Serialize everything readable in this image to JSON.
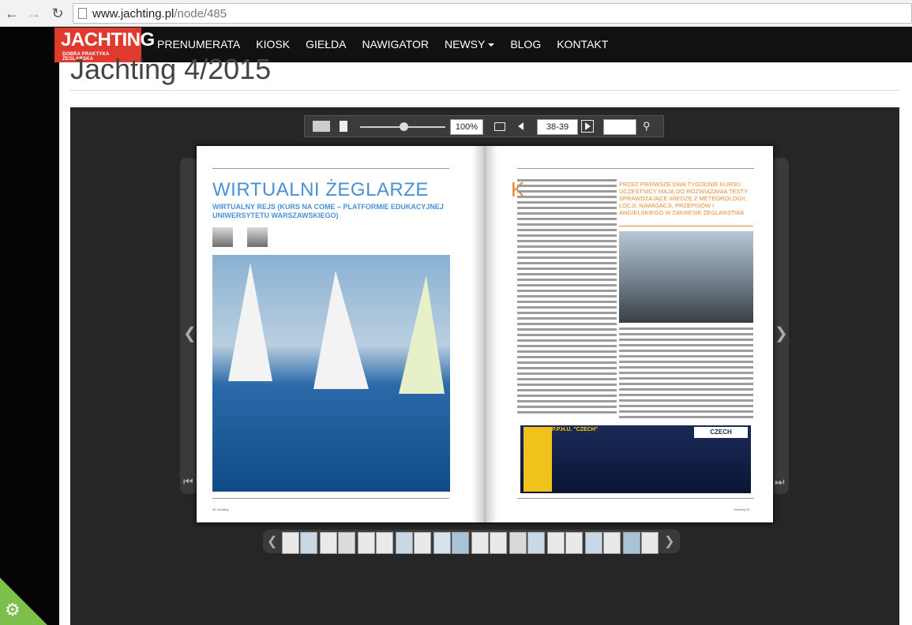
{
  "browser": {
    "url_host": "www.jachting.pl",
    "url_path": "/node/485"
  },
  "nav": {
    "logo_main": "JACHTING",
    "logo_sub": "DOBRA PRAKTYKA ŻEGLARSKA",
    "items": [
      "PRENUMERATA",
      "KIOSK",
      "GIEŁDA",
      "NAWIGATOR",
      "NEWSY",
      "BLOG",
      "KONTAKT"
    ]
  },
  "page": {
    "title": "Jachting 4/2015"
  },
  "viewer": {
    "zoom": "100%",
    "pages": "38-39",
    "search_value": ""
  },
  "left_page": {
    "title": "WIRTUALNI ŻEGLARZE",
    "subtitle": "WIRTUALNY REJS (KURS NA COME – PLATFORMIE EDUKACYJNEJ UNIWERSYTETU WARSZAWSKIEGO)",
    "folio": "38 Jachting"
  },
  "right_page": {
    "dropcap": "K",
    "pull_quote": "PRZEZ PIERWSZE DWA TYGODNIE KURSU UCZESTNICY MAJĄ DO ROZWIĄZANIA TESTY SPRAWDZAJĄCE WIEDZĘ Z METEOROLOGII, LOCJI, NAWIGACJI, PRZEPISÓW I ANGIELSKIEGO W ZAKRESIE ŻEGLARSTWA",
    "ad_company": "P.P.H.U. \"CZECH\"",
    "ad_logo": "CZECH",
    "folio": "Jachting 39"
  },
  "colors": {
    "accent": "#e03a2f",
    "title_blue": "#4a90d6",
    "orange": "#e98a2f"
  }
}
